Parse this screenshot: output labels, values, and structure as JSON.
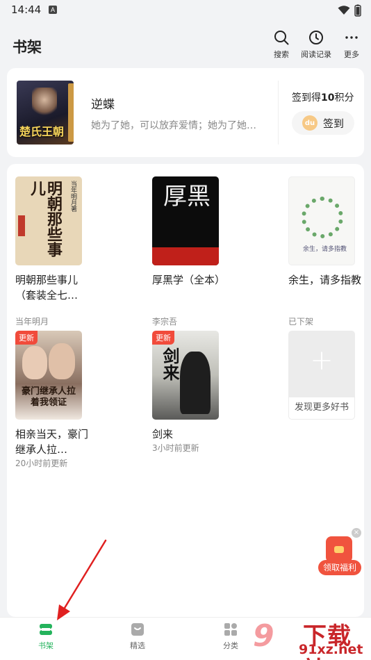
{
  "status_bar": {
    "time": "14:44",
    "notification_glyph": "A"
  },
  "header": {
    "title": "书架",
    "actions": [
      {
        "icon": "search-icon",
        "label": "搜索"
      },
      {
        "icon": "clock-icon",
        "label": "阅读记录"
      },
      {
        "icon": "more-icon",
        "label": "更多"
      }
    ]
  },
  "recommendation": {
    "title": "逆蝶",
    "description": "她为了她，可以放弃爱情；她为了她…",
    "cover_text": "楚氏王朝",
    "checkin_prefix": "签到得",
    "checkin_points": "10",
    "checkin_suffix": "积分",
    "coin_label": "du",
    "checkin_button": "签到"
  },
  "shelf": {
    "books": [
      {
        "title": "明朝那些事儿（套装全七…",
        "subtitle": "当年明月",
        "cover_title": "明朝那些事儿",
        "cover_author": "当年明月著",
        "badge": ""
      },
      {
        "title": "厚黑学（全本）",
        "subtitle": "李宗吾",
        "cover_title": "厚黑",
        "badge": ""
      },
      {
        "title": "余生，请多指教",
        "subtitle": "已下架",
        "cover_title": "余生，请多指教",
        "badge": ""
      },
      {
        "title": "相亲当天，豪门继承人拉…",
        "subtitle": "20小时前更新",
        "cover_title": "豪门继承人拉着我领证",
        "badge": "更新"
      },
      {
        "title": "剑来",
        "subtitle": "3小时前更新",
        "cover_title": "剑来",
        "badge": "更新"
      }
    ],
    "add_more": {
      "label": "发现更多好书",
      "plus": "+"
    }
  },
  "gift": {
    "label": "领取福利",
    "close": "×"
  },
  "tabbar": {
    "tabs": [
      {
        "label": "书架",
        "active": true,
        "icon": "bookshelf-icon"
      },
      {
        "label": "精选",
        "active": false,
        "icon": "featured-icon"
      },
      {
        "label": "分类",
        "active": false,
        "icon": "category-icon"
      }
    ]
  },
  "watermark": {
    "text": "下载站",
    "url": "91xz.net",
    "logo": "9"
  },
  "colors": {
    "accent": "#24b35c",
    "badge": "#f14b3b",
    "background": "#f2f3f5",
    "annotation_arrow": "#e02020"
  }
}
